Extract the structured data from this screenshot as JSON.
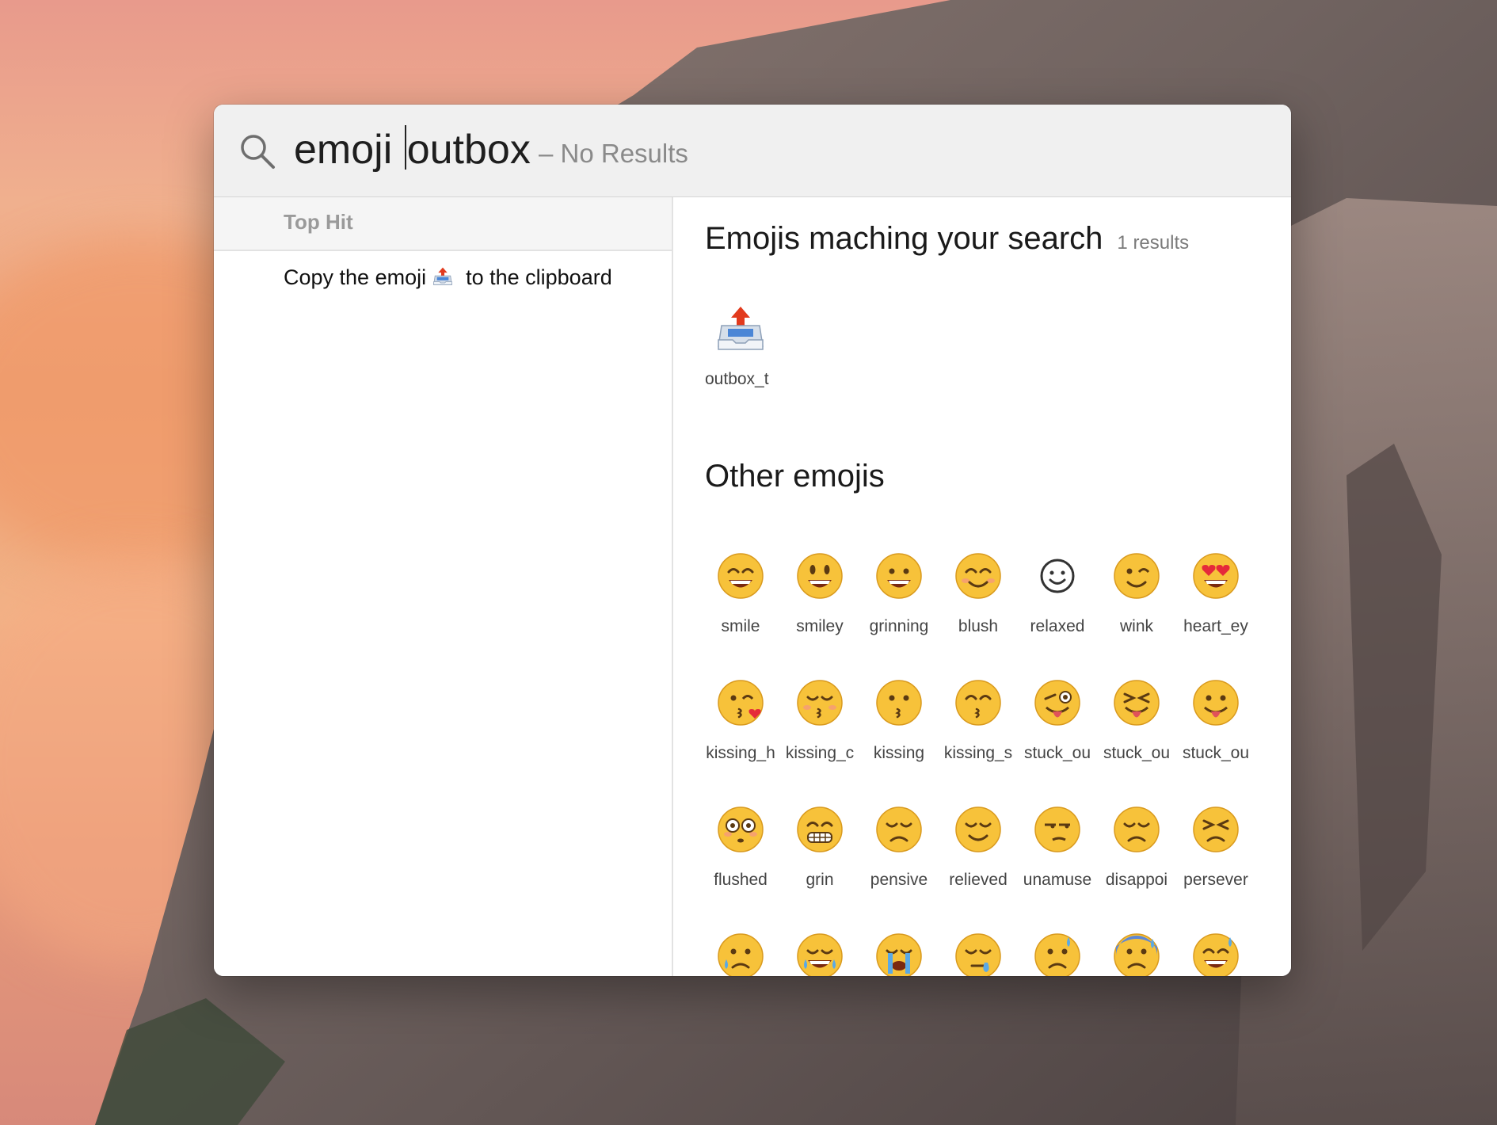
{
  "search": {
    "query_before_caret": "emoji ",
    "query_after_caret": "outbox",
    "status": "– No Results"
  },
  "left_pane": {
    "section_label": "Top Hit",
    "result": {
      "prefix": "Copy the emoji",
      "suffix": "to the clipboard",
      "icon": "outbox-tray-icon"
    }
  },
  "right_pane": {
    "matching_title": "Emojis maching your search",
    "matching_count": "1 results",
    "matching": [
      {
        "label": "outbox_t",
        "icon": "outbox-tray-icon"
      }
    ],
    "other_title": "Other emojis",
    "other": [
      {
        "label": "smile",
        "icon": "smile-icon"
      },
      {
        "label": "smiley",
        "icon": "smiley-icon"
      },
      {
        "label": "grinning",
        "icon": "grinning-icon"
      },
      {
        "label": "blush",
        "icon": "blush-icon"
      },
      {
        "label": "relaxed",
        "icon": "relaxed-icon"
      },
      {
        "label": "wink",
        "icon": "wink-icon"
      },
      {
        "label": "heart_ey",
        "icon": "heart-eyes-icon"
      },
      {
        "label": "kissing_h",
        "icon": "kissing-heart-icon"
      },
      {
        "label": "kissing_c",
        "icon": "kissing-closed-eyes-icon"
      },
      {
        "label": "kissing",
        "icon": "kissing-icon"
      },
      {
        "label": "kissing_s",
        "icon": "kissing-smiling-eyes-icon"
      },
      {
        "label": "stuck_ou",
        "icon": "stuck-out-tongue-winking-eye-icon"
      },
      {
        "label": "stuck_ou",
        "icon": "stuck-out-tongue-closed-eyes-icon"
      },
      {
        "label": "stuck_ou",
        "icon": "stuck-out-tongue-icon"
      },
      {
        "label": "flushed",
        "icon": "flushed-icon"
      },
      {
        "label": "grin",
        "icon": "grin-icon"
      },
      {
        "label": "pensive",
        "icon": "pensive-icon"
      },
      {
        "label": "relieved",
        "icon": "relieved-icon"
      },
      {
        "label": "unamuse",
        "icon": "unamused-icon"
      },
      {
        "label": "disappoi",
        "icon": "disappointed-icon"
      },
      {
        "label": "persever",
        "icon": "persevere-icon"
      },
      {
        "label": "",
        "icon": "cry-icon"
      },
      {
        "label": "",
        "icon": "joy-icon"
      },
      {
        "label": "",
        "icon": "sob-icon"
      },
      {
        "label": "",
        "icon": "sleepy-icon"
      },
      {
        "label": "",
        "icon": "disappointed-relieved-icon"
      },
      {
        "label": "",
        "icon": "cold-sweat-icon"
      },
      {
        "label": "",
        "icon": "sweat-smile-icon"
      }
    ]
  },
  "colors": {
    "search_bar_bg": "#f0f0f0",
    "header_bg": "#f5f5f5",
    "emoji_yellow": "#f7c23a",
    "emoji_outline": "#d99a1e",
    "muted_text": "#8a8a8a"
  }
}
